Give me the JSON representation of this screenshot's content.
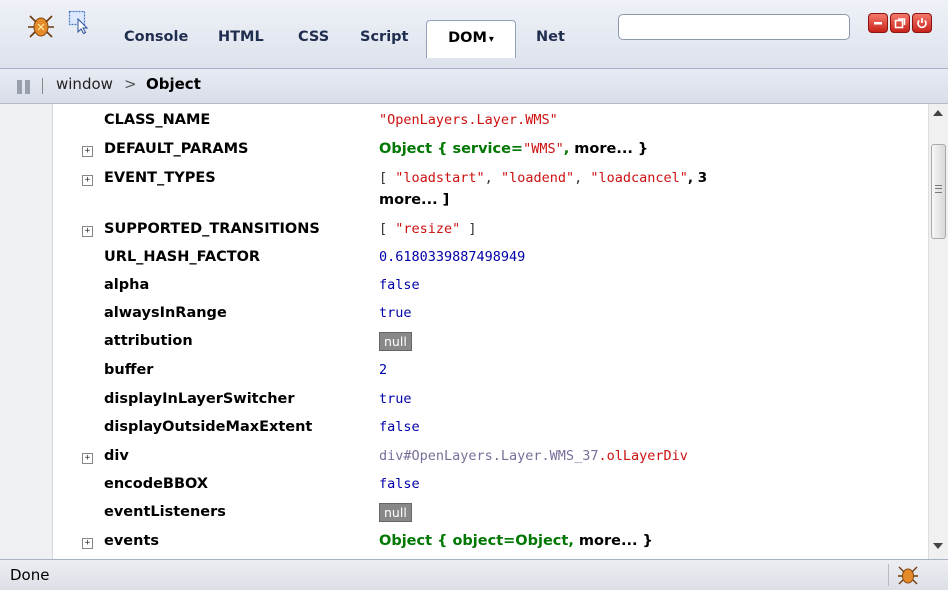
{
  "toolbar": {
    "tabs": {
      "console": "Console",
      "html": "HTML",
      "css": "CSS",
      "script": "Script",
      "dom": "DOM",
      "net": "Net"
    },
    "dom_arrow": "▾",
    "search_value": "",
    "icons": [
      "firebug-icon",
      "inspect-icon",
      "minimize-icon",
      "restore-icon",
      "close-icon"
    ],
    "window_button_color": "#d8332a"
  },
  "breadcrumb": {
    "root": "window",
    "separator": ">",
    "current": "Object"
  },
  "dom_rows": [
    {
      "name": "CLASS_NAME",
      "expandable": false,
      "value": "\"OpenLayers.Layer.WMS\"",
      "kind": "string"
    },
    {
      "name": "DEFAULT_PARAMS",
      "expandable": true,
      "value_parts": [
        "Object { ",
        "service=",
        "\"WMS\"",
        ", ",
        " more... }"
      ],
      "kind": "object"
    },
    {
      "name": "EVENT_TYPES",
      "expandable": true,
      "line1": [
        "[ ",
        "\"loadstart\"",
        ", ",
        "\"loadend\"",
        ", ",
        "\"loadcancel\"",
        ", 3"
      ],
      "line2": "more... ]",
      "kind": "array"
    },
    {
      "name": "SUPPORTED_TRANSITIONS",
      "expandable": true,
      "value_parts": [
        "[ ",
        "\"resize\"",
        " ]"
      ],
      "kind": "array"
    },
    {
      "name": "URL_HASH_FACTOR",
      "expandable": false,
      "value": "0.6180339887498949",
      "kind": "number"
    },
    {
      "name": "alpha",
      "expandable": false,
      "value": "false",
      "kind": "number"
    },
    {
      "name": "alwaysInRange",
      "expandable": false,
      "value": "true",
      "kind": "number"
    },
    {
      "name": "attribution",
      "expandable": false,
      "value": "null",
      "kind": "null"
    },
    {
      "name": "buffer",
      "expandable": false,
      "value": "2",
      "kind": "number"
    },
    {
      "name": "displayInLayerSwitcher",
      "expandable": false,
      "value": "true",
      "kind": "number"
    },
    {
      "name": "displayOutsideMaxExtent",
      "expandable": false,
      "value": "false",
      "kind": "number"
    },
    {
      "name": "div",
      "expandable": true,
      "value_parts": [
        "div#OpenLayers.Layer.WMS_37",
        ".olLayerDiv"
      ],
      "kind": "element"
    },
    {
      "name": "encodeBBOX",
      "expandable": false,
      "value": "false",
      "kind": "number"
    },
    {
      "name": "eventListeners",
      "expandable": false,
      "value": "null",
      "kind": "null"
    },
    {
      "name": "events",
      "expandable": true,
      "value_parts": [
        "Object { ",
        "object=Object",
        ", ",
        " more... }"
      ],
      "kind": "object"
    }
  ],
  "colors": {
    "string": "#cc1111",
    "number": "#0000aa",
    "object": "#007700"
  },
  "status": {
    "text": "Done"
  },
  "twisty_symbol": "+"
}
